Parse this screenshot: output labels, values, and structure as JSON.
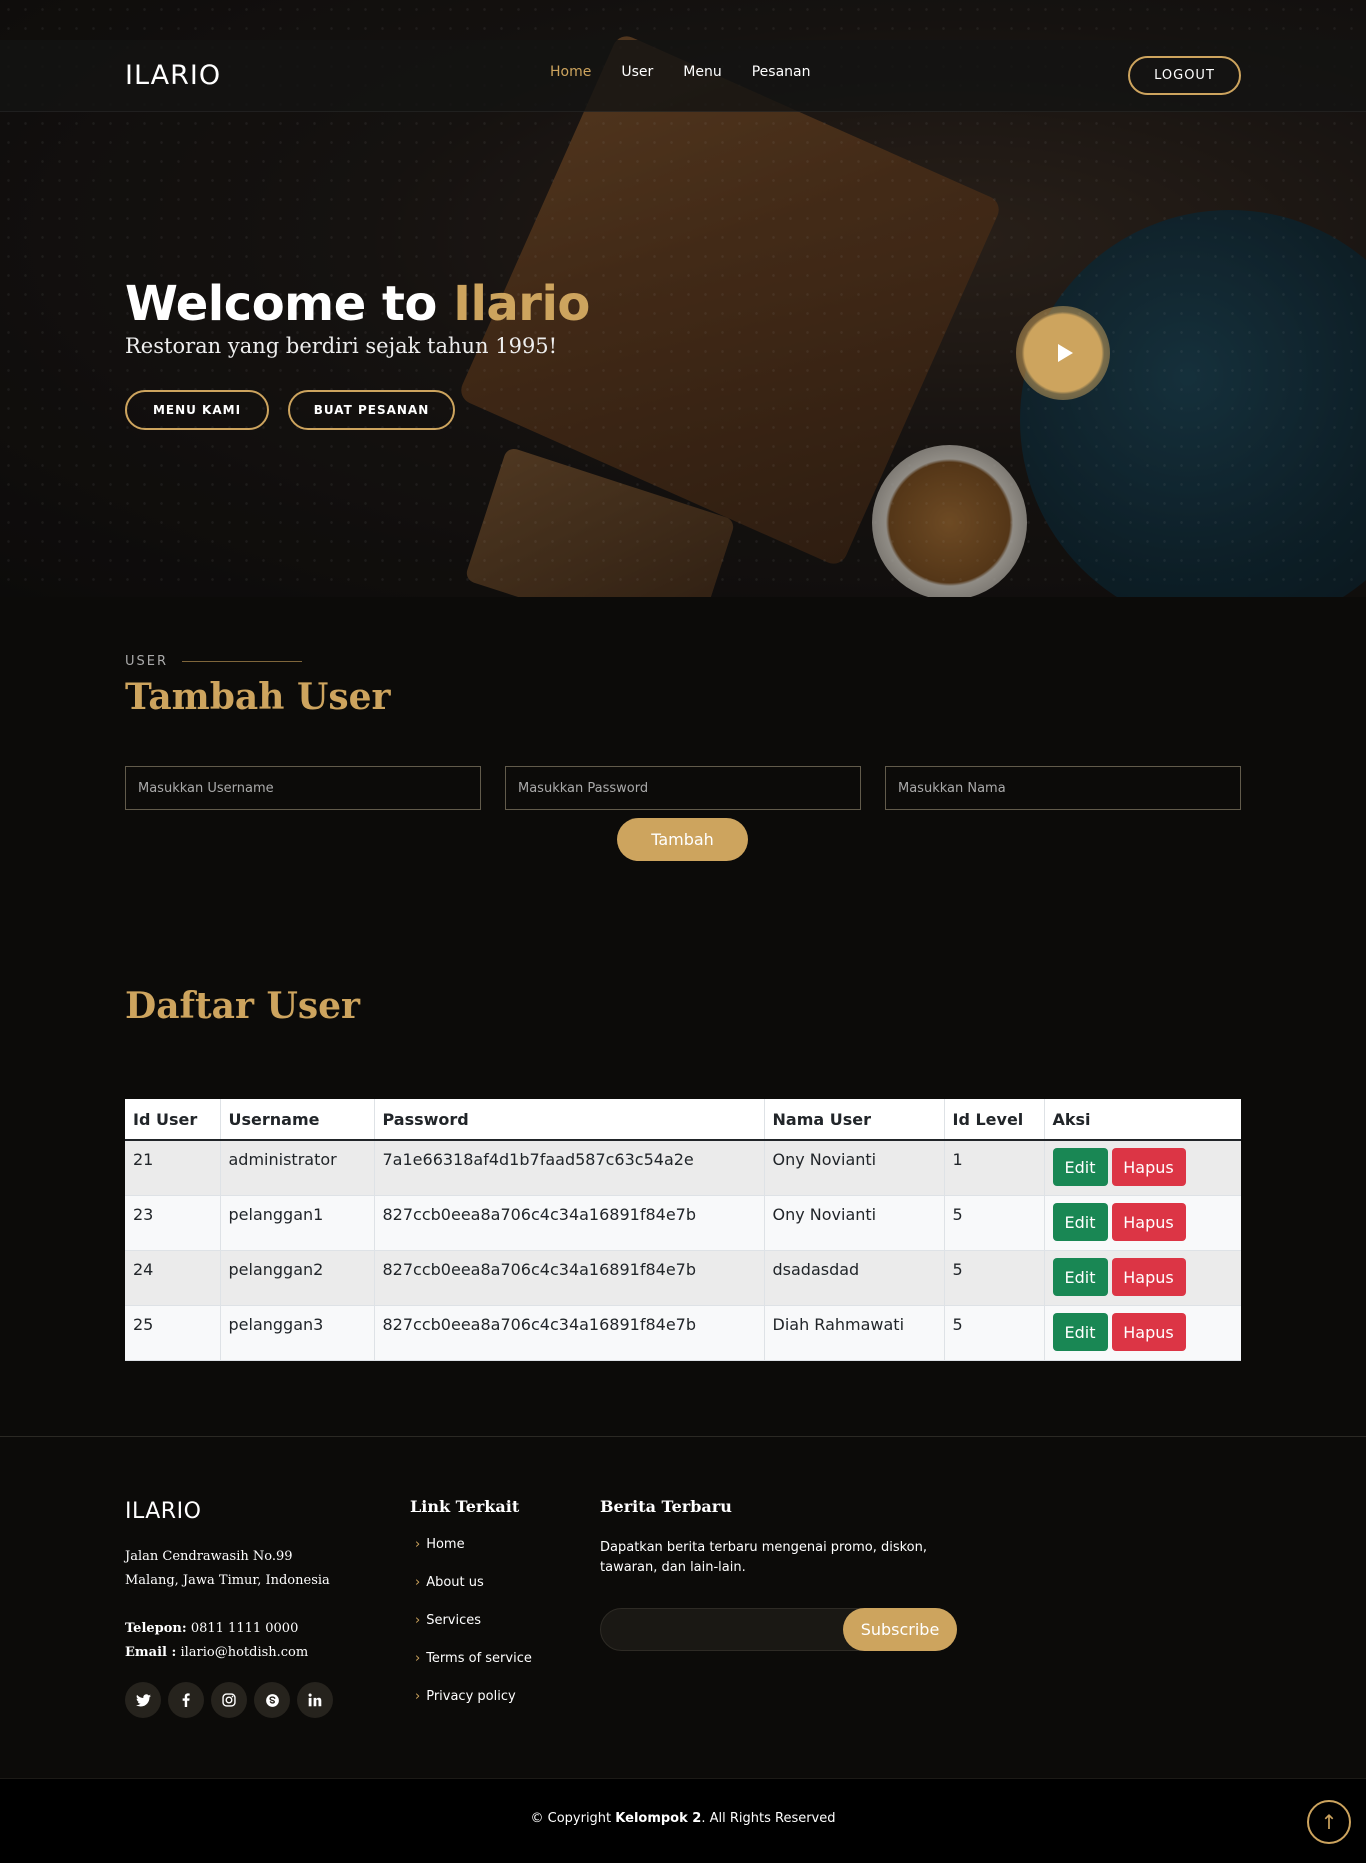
{
  "header": {
    "logo": "ILARIO",
    "nav": [
      "Home",
      "User",
      "Menu",
      "Pesanan"
    ],
    "logout_label": "LOGOUT"
  },
  "hero": {
    "title_prefix": "Welcome to ",
    "title_accent": "Ilario",
    "subtitle": "Restoran yang berdiri sejak tahun 1995!",
    "btn_menu": "MENU KAMI",
    "btn_order": "BUAT PESANAN"
  },
  "form": {
    "section_label": "USER",
    "title": "Tambah User",
    "username_placeholder": "Masukkan Username",
    "password_placeholder": "Masukkan Password",
    "nama_placeholder": "Masukkan Nama",
    "submit_label": "Tambah"
  },
  "list": {
    "title": "Daftar User",
    "columns": [
      "Id User",
      "Username",
      "Password",
      "Nama User",
      "Id Level",
      "Aksi"
    ],
    "rows": [
      {
        "id": "21",
        "username": "administrator",
        "password": "7a1e66318af4d1b7faad587c63c54a2e",
        "nama": "Ony Novianti",
        "level": "1"
      },
      {
        "id": "23",
        "username": "pelanggan1",
        "password": "827ccb0eea8a706c4c34a16891f84e7b",
        "nama": "Ony Novianti",
        "level": "5"
      },
      {
        "id": "24",
        "username": "pelanggan2",
        "password": "827ccb0eea8a706c4c34a16891f84e7b",
        "nama": "dsadasdad",
        "level": "5"
      },
      {
        "id": "25",
        "username": "pelanggan3",
        "password": "827ccb0eea8a706c4c34a16891f84e7b",
        "nama": "Diah Rahmawati",
        "level": "5"
      }
    ],
    "edit_label": "Edit",
    "delete_label": "Hapus"
  },
  "footer": {
    "logo": "ILARIO",
    "address_line1": "Jalan Cendrawasih No.99",
    "address_line2": "Malang, Jawa Timur, Indonesia",
    "phone_label": "Telepon:",
    "phone": "0811 1111 0000",
    "email_label": "Email :",
    "email": "ilario@hotdish.com",
    "links_title": "Link Terkait",
    "links": [
      "Home",
      "About us",
      "Services",
      "Terms of service",
      "Privacy policy"
    ],
    "news_title": "Berita Terbaru",
    "news_text": "Dapatkan berita terbaru mengenai promo, diskon, tawaran, dan lain-lain.",
    "subscribe_label": "Subscribe",
    "copyright_prefix": "© Copyright ",
    "copyright_owner": "Kelompok 2",
    "copyright_suffix": ". All Rights Reserved"
  },
  "colors": {
    "accent": "#cda45e",
    "edit": "#198754",
    "delete": "#dc3545"
  },
  "icons": [
    "play-icon",
    "twitter-icon",
    "facebook-icon",
    "instagram-icon",
    "skype-icon",
    "linkedin-icon",
    "chevron-right-icon",
    "arrow-up-icon"
  ]
}
